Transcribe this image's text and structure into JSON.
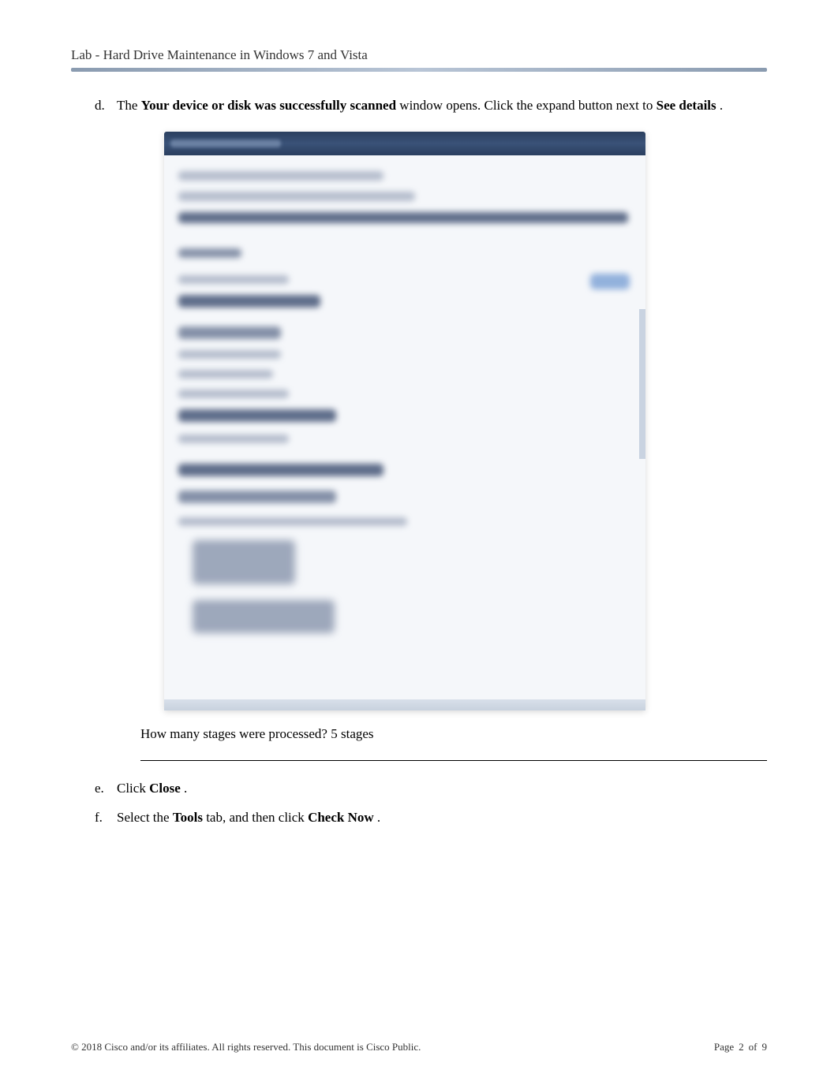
{
  "header": {
    "title": "Lab - Hard Drive Maintenance in Windows 7 and Vista"
  },
  "items": {
    "d": {
      "marker": "d.",
      "text_prefix": "The ",
      "bold1": "Your device or disk was successfully scanned",
      "text_mid": " window opens. Click the expand button next to ",
      "bold2": "See details",
      "text_suffix": "."
    },
    "question": {
      "label": "How many stages were processed? ",
      "answer": "5 stages"
    },
    "e": {
      "marker": "e.",
      "text_prefix": "Click ",
      "bold1": "Close",
      "text_suffix": "."
    },
    "f": {
      "marker": "f.",
      "text_prefix": "Select the ",
      "bold1": "Tools",
      "text_mid": " tab, and then click ",
      "bold2": "Check Now",
      "text_suffix": "."
    }
  },
  "footer": {
    "copyright": "© 2018 Cisco and/or its affiliates. All rights reserved. This document is Cisco Public.",
    "page_label": "Page",
    "page_current": "2",
    "page_sep": "of",
    "page_total": "9"
  }
}
